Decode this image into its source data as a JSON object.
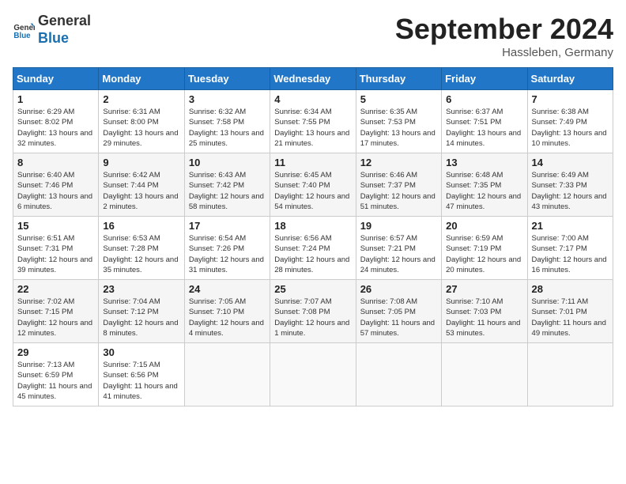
{
  "header": {
    "logo_general": "General",
    "logo_blue": "Blue",
    "month_title": "September 2024",
    "location": "Hassleben, Germany"
  },
  "days_of_week": [
    "Sunday",
    "Monday",
    "Tuesday",
    "Wednesday",
    "Thursday",
    "Friday",
    "Saturday"
  ],
  "weeks": [
    [
      {
        "day": "1",
        "sunrise": "Sunrise: 6:29 AM",
        "sunset": "Sunset: 8:02 PM",
        "daylight": "Daylight: 13 hours and 32 minutes."
      },
      {
        "day": "2",
        "sunrise": "Sunrise: 6:31 AM",
        "sunset": "Sunset: 8:00 PM",
        "daylight": "Daylight: 13 hours and 29 minutes."
      },
      {
        "day": "3",
        "sunrise": "Sunrise: 6:32 AM",
        "sunset": "Sunset: 7:58 PM",
        "daylight": "Daylight: 13 hours and 25 minutes."
      },
      {
        "day": "4",
        "sunrise": "Sunrise: 6:34 AM",
        "sunset": "Sunset: 7:55 PM",
        "daylight": "Daylight: 13 hours and 21 minutes."
      },
      {
        "day": "5",
        "sunrise": "Sunrise: 6:35 AM",
        "sunset": "Sunset: 7:53 PM",
        "daylight": "Daylight: 13 hours and 17 minutes."
      },
      {
        "day": "6",
        "sunrise": "Sunrise: 6:37 AM",
        "sunset": "Sunset: 7:51 PM",
        "daylight": "Daylight: 13 hours and 14 minutes."
      },
      {
        "day": "7",
        "sunrise": "Sunrise: 6:38 AM",
        "sunset": "Sunset: 7:49 PM",
        "daylight": "Daylight: 13 hours and 10 minutes."
      }
    ],
    [
      {
        "day": "8",
        "sunrise": "Sunrise: 6:40 AM",
        "sunset": "Sunset: 7:46 PM",
        "daylight": "Daylight: 13 hours and 6 minutes."
      },
      {
        "day": "9",
        "sunrise": "Sunrise: 6:42 AM",
        "sunset": "Sunset: 7:44 PM",
        "daylight": "Daylight: 13 hours and 2 minutes."
      },
      {
        "day": "10",
        "sunrise": "Sunrise: 6:43 AM",
        "sunset": "Sunset: 7:42 PM",
        "daylight": "Daylight: 12 hours and 58 minutes."
      },
      {
        "day": "11",
        "sunrise": "Sunrise: 6:45 AM",
        "sunset": "Sunset: 7:40 PM",
        "daylight": "Daylight: 12 hours and 54 minutes."
      },
      {
        "day": "12",
        "sunrise": "Sunrise: 6:46 AM",
        "sunset": "Sunset: 7:37 PM",
        "daylight": "Daylight: 12 hours and 51 minutes."
      },
      {
        "day": "13",
        "sunrise": "Sunrise: 6:48 AM",
        "sunset": "Sunset: 7:35 PM",
        "daylight": "Daylight: 12 hours and 47 minutes."
      },
      {
        "day": "14",
        "sunrise": "Sunrise: 6:49 AM",
        "sunset": "Sunset: 7:33 PM",
        "daylight": "Daylight: 12 hours and 43 minutes."
      }
    ],
    [
      {
        "day": "15",
        "sunrise": "Sunrise: 6:51 AM",
        "sunset": "Sunset: 7:31 PM",
        "daylight": "Daylight: 12 hours and 39 minutes."
      },
      {
        "day": "16",
        "sunrise": "Sunrise: 6:53 AM",
        "sunset": "Sunset: 7:28 PM",
        "daylight": "Daylight: 12 hours and 35 minutes."
      },
      {
        "day": "17",
        "sunrise": "Sunrise: 6:54 AM",
        "sunset": "Sunset: 7:26 PM",
        "daylight": "Daylight: 12 hours and 31 minutes."
      },
      {
        "day": "18",
        "sunrise": "Sunrise: 6:56 AM",
        "sunset": "Sunset: 7:24 PM",
        "daylight": "Daylight: 12 hours and 28 minutes."
      },
      {
        "day": "19",
        "sunrise": "Sunrise: 6:57 AM",
        "sunset": "Sunset: 7:21 PM",
        "daylight": "Daylight: 12 hours and 24 minutes."
      },
      {
        "day": "20",
        "sunrise": "Sunrise: 6:59 AM",
        "sunset": "Sunset: 7:19 PM",
        "daylight": "Daylight: 12 hours and 20 minutes."
      },
      {
        "day": "21",
        "sunrise": "Sunrise: 7:00 AM",
        "sunset": "Sunset: 7:17 PM",
        "daylight": "Daylight: 12 hours and 16 minutes."
      }
    ],
    [
      {
        "day": "22",
        "sunrise": "Sunrise: 7:02 AM",
        "sunset": "Sunset: 7:15 PM",
        "daylight": "Daylight: 12 hours and 12 minutes."
      },
      {
        "day": "23",
        "sunrise": "Sunrise: 7:04 AM",
        "sunset": "Sunset: 7:12 PM",
        "daylight": "Daylight: 12 hours and 8 minutes."
      },
      {
        "day": "24",
        "sunrise": "Sunrise: 7:05 AM",
        "sunset": "Sunset: 7:10 PM",
        "daylight": "Daylight: 12 hours and 4 minutes."
      },
      {
        "day": "25",
        "sunrise": "Sunrise: 7:07 AM",
        "sunset": "Sunset: 7:08 PM",
        "daylight": "Daylight: 12 hours and 1 minute."
      },
      {
        "day": "26",
        "sunrise": "Sunrise: 7:08 AM",
        "sunset": "Sunset: 7:05 PM",
        "daylight": "Daylight: 11 hours and 57 minutes."
      },
      {
        "day": "27",
        "sunrise": "Sunrise: 7:10 AM",
        "sunset": "Sunset: 7:03 PM",
        "daylight": "Daylight: 11 hours and 53 minutes."
      },
      {
        "day": "28",
        "sunrise": "Sunrise: 7:11 AM",
        "sunset": "Sunset: 7:01 PM",
        "daylight": "Daylight: 11 hours and 49 minutes."
      }
    ],
    [
      {
        "day": "29",
        "sunrise": "Sunrise: 7:13 AM",
        "sunset": "Sunset: 6:59 PM",
        "daylight": "Daylight: 11 hours and 45 minutes."
      },
      {
        "day": "30",
        "sunrise": "Sunrise: 7:15 AM",
        "sunset": "Sunset: 6:56 PM",
        "daylight": "Daylight: 11 hours and 41 minutes."
      },
      null,
      null,
      null,
      null,
      null
    ]
  ]
}
